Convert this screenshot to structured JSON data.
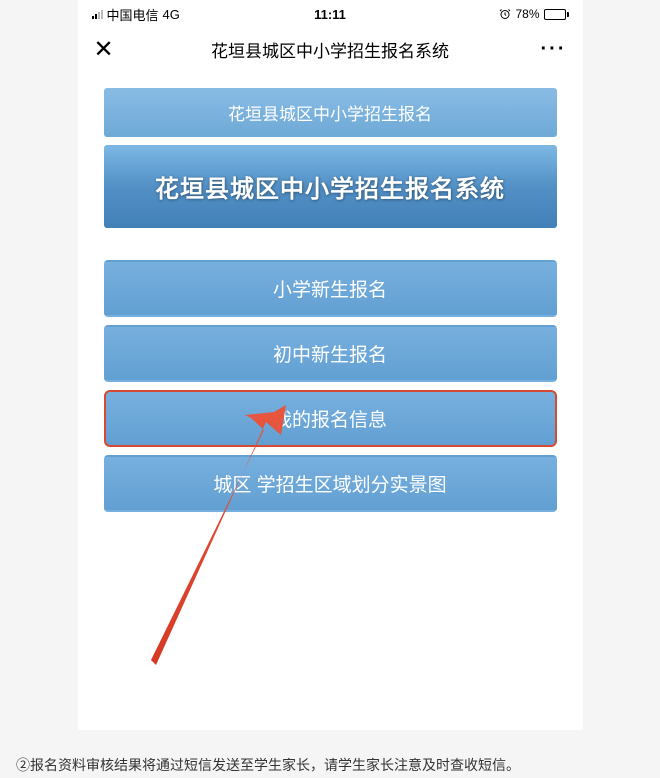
{
  "status_bar": {
    "carrier": "中国电信",
    "network": "4G",
    "time": "11:11",
    "battery_percent": "78%"
  },
  "nav": {
    "close": "✕",
    "title": "花垣县城区中小学招生报名系统",
    "more": "···"
  },
  "header": {
    "subtitle": "花垣县城区中小学招生报名",
    "hero_title": "花垣县城区中小学招生报名系统"
  },
  "menu": {
    "items": [
      {
        "label": "小学新生报名",
        "highlighted": false
      },
      {
        "label": "初中新生报名",
        "highlighted": false
      },
      {
        "label": "我的报名信息",
        "highlighted": true
      },
      {
        "label": "城区    学招生区域划分实景图",
        "highlighted": false
      }
    ]
  },
  "instruction": "②报名资料审核结果将通过短信发送至学生家长，请学生家长注意及时查收短信。"
}
